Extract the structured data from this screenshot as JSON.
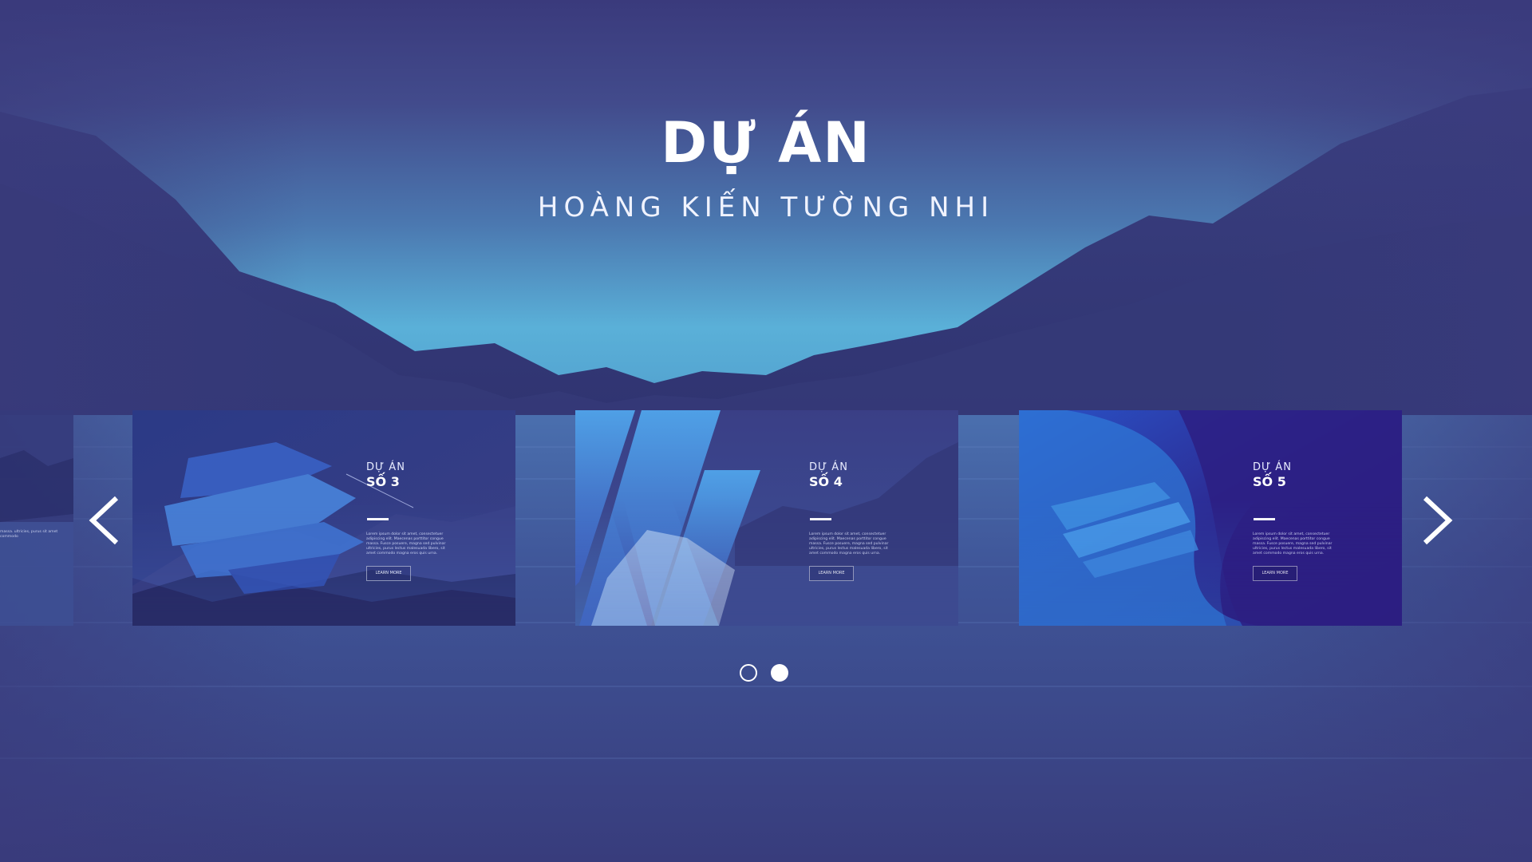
{
  "hero": {
    "title": "DỰ ÁN",
    "subtitle": "HOÀNG KIẾN TƯỜNG NHI"
  },
  "carousel": {
    "cards": [
      {
        "label_top": "DỰ ÁN",
        "label_num": "SỐ 3",
        "button": "LEARN MORE",
        "body": "Lorem ipsum dolor sit amet, consectetuer adipiscing elit. Maecenas porttitor congue massa. Fusce posuere, magna sed pulvinar ultricies, purus lectus malesuada libero, sit amet commodo magna eros quis urna."
      },
      {
        "label_top": "DỰ ÁN",
        "label_num": "SỐ 4",
        "button": "LEARN MORE",
        "body": "Lorem ipsum dolor sit amet, consectetuer adipiscing elit. Maecenas porttitor congue massa. Fusce posuere, magna sed pulvinar ultricies, purus lectus malesuada libero, sit amet commodo magna eros quis urna."
      },
      {
        "label_top": "DỰ ÁN",
        "label_num": "SỐ 5",
        "button": "LEARN MORE",
        "body": "Lorem ipsum dolor sit amet, consectetuer adipiscing elit. Maecenas porttitor congue massa. Fusce posuere, magna sed pulvinar ultricies, purus lectus malesuada libero, sit amet commodo magna eros quis urna."
      }
    ],
    "side_card_text": "massa. ultricies, purus sit amet commodo",
    "pagination": {
      "total": 2,
      "active_index": 1
    },
    "prev_icon": "chevron-left-icon",
    "next_icon": "chevron-right-icon"
  },
  "colors": {
    "background": "#3b3b7e",
    "sky": "#5ab0d8",
    "mountain": "#363a78",
    "text": "#ffffff"
  }
}
